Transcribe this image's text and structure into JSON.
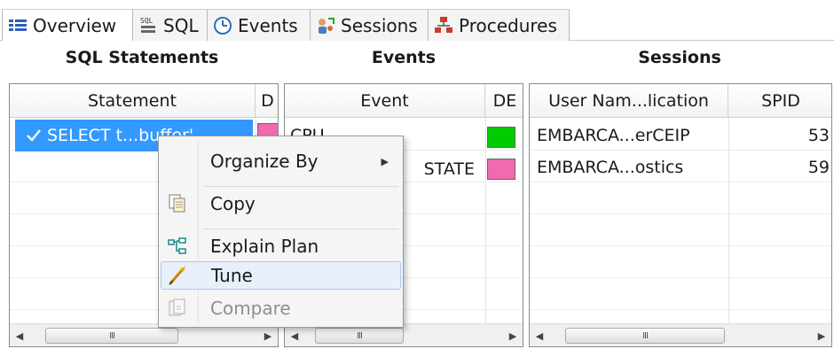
{
  "tabs": [
    {
      "label": "Overview",
      "icon": "overview-icon",
      "active": true
    },
    {
      "label": "SQL",
      "icon": "sql-icon",
      "active": false
    },
    {
      "label": "Events",
      "icon": "clock-icon",
      "active": false
    },
    {
      "label": "Sessions",
      "icon": "sessions-icon",
      "active": false
    },
    {
      "label": "Procedures",
      "icon": "procedures-icon",
      "active": false
    }
  ],
  "panels": {
    "sql": {
      "title": "SQL Statements",
      "columns": [
        "Statement",
        "D"
      ],
      "rows": [
        {
          "statement": "SELECT t...buffer'",
          "status_icon": "checkmark-icon",
          "swatch": "#f06aaf",
          "selected": true
        }
      ]
    },
    "events": {
      "title": "Events",
      "columns": [
        "Event",
        "DE"
      ],
      "rows": [
        {
          "event": "CPU",
          "swatch": "#00cc00"
        },
        {
          "event": "STATE",
          "swatch": "#f06aaf"
        }
      ]
    },
    "sessions": {
      "title": "Sessions",
      "columns": [
        "User Nam...lication",
        "SPID"
      ],
      "rows": [
        {
          "user": "EMBARCA...erCEIP",
          "spid": "53"
        },
        {
          "user": "EMBARCA...ostics",
          "spid": "59"
        }
      ]
    }
  },
  "context_menu": {
    "items": [
      {
        "label": "Organize By",
        "icon": "",
        "submenu": true,
        "enabled": true,
        "highlighted": false
      },
      {
        "label": "Copy",
        "icon": "copy-icon",
        "submenu": false,
        "enabled": true,
        "highlighted": false
      },
      {
        "label": "Explain Plan",
        "icon": "explain-plan-icon",
        "submenu": false,
        "enabled": true,
        "highlighted": false
      },
      {
        "label": "Tune",
        "icon": "tune-icon",
        "submenu": false,
        "enabled": true,
        "highlighted": true
      },
      {
        "label": "Compare",
        "icon": "compare-icon",
        "submenu": false,
        "enabled": false,
        "highlighted": false
      }
    ]
  },
  "scrollbar": {
    "left_arrow": "◀",
    "right_arrow": "▶",
    "grip": "III"
  },
  "colors": {
    "selection": "#3399ff",
    "menu_highlight": "#e7f0fb",
    "pink": "#f06aaf",
    "green": "#00cc00"
  }
}
